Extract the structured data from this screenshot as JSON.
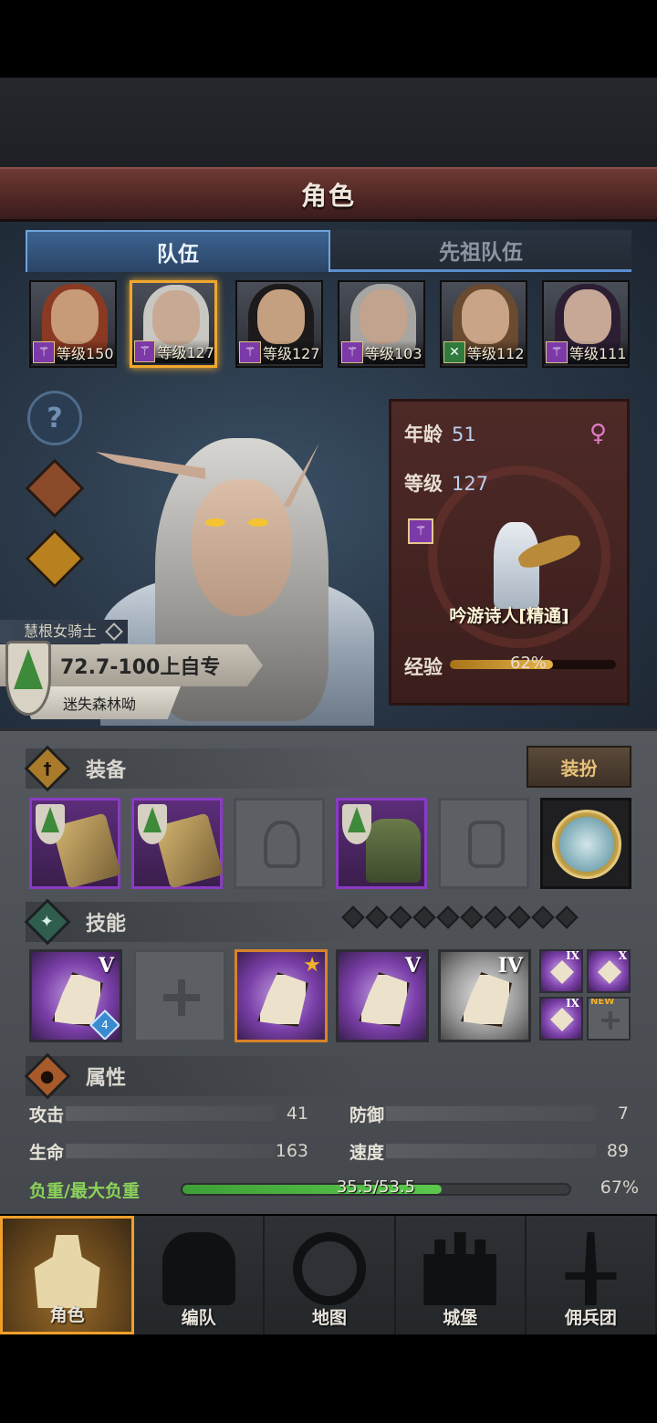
{
  "header": {
    "title": "角色"
  },
  "tabs": [
    {
      "label": "队伍",
      "active": true
    },
    {
      "label": "先祖队伍",
      "active": false
    }
  ],
  "party": [
    {
      "level": "等级150",
      "class_icon": "staff-icon",
      "badge_color": "purple"
    },
    {
      "level": "等级127",
      "class_icon": "staff-icon",
      "badge_color": "purple",
      "selected": true
    },
    {
      "level": "等级127",
      "class_icon": "staff-icon",
      "badge_color": "purple"
    },
    {
      "level": "等级103",
      "class_icon": "staff-icon",
      "badge_color": "purple"
    },
    {
      "level": "等级112",
      "class_icon": "crossed-swords-icon",
      "badge_color": "green"
    },
    {
      "level": "等级111",
      "class_icon": "staff-icon",
      "badge_color": "purple"
    }
  ],
  "character": {
    "title": "慧根女骑士",
    "trait": "72.7-100上自专",
    "region": "迷失森林呦",
    "age_label": "年龄",
    "age": "51",
    "level_label": "等级",
    "level": "127",
    "job": "吟游诗人[精通]",
    "exp_label": "经验",
    "exp_text": "62%",
    "exp_fraction": 0.62,
    "gender_symbol": "♀"
  },
  "equipment": {
    "title": "装备",
    "dress_button": "装扮"
  },
  "skills": {
    "title": "技能",
    "ranks": [
      "V",
      "",
      "",
      "V",
      "IV"
    ],
    "badge_number": "4",
    "mini_ranks": [
      "IX",
      "X",
      "IX",
      ""
    ],
    "new_label": "NEW"
  },
  "attributes": {
    "title": "属性",
    "attack_label": "攻击",
    "attack": "41",
    "defense_label": "防御",
    "defense": "7",
    "hp_label": "生命",
    "hp": "163",
    "speed_label": "速度",
    "speed": "89",
    "load_label": "负重/最大负重",
    "load_text": "35.5/53.5",
    "load_pct": "67%",
    "load_fraction": 0.67
  },
  "nav": [
    {
      "label": "角色",
      "active": true
    },
    {
      "label": "编队"
    },
    {
      "label": "地图"
    },
    {
      "label": "城堡"
    },
    {
      "label": "佣兵团"
    }
  ],
  "colors": {
    "accent_gold": "#f0a82c",
    "tab_blue": "#6fa3dd",
    "rarity_purple": "#8a3bc4",
    "load_green": "#5cc84c"
  }
}
